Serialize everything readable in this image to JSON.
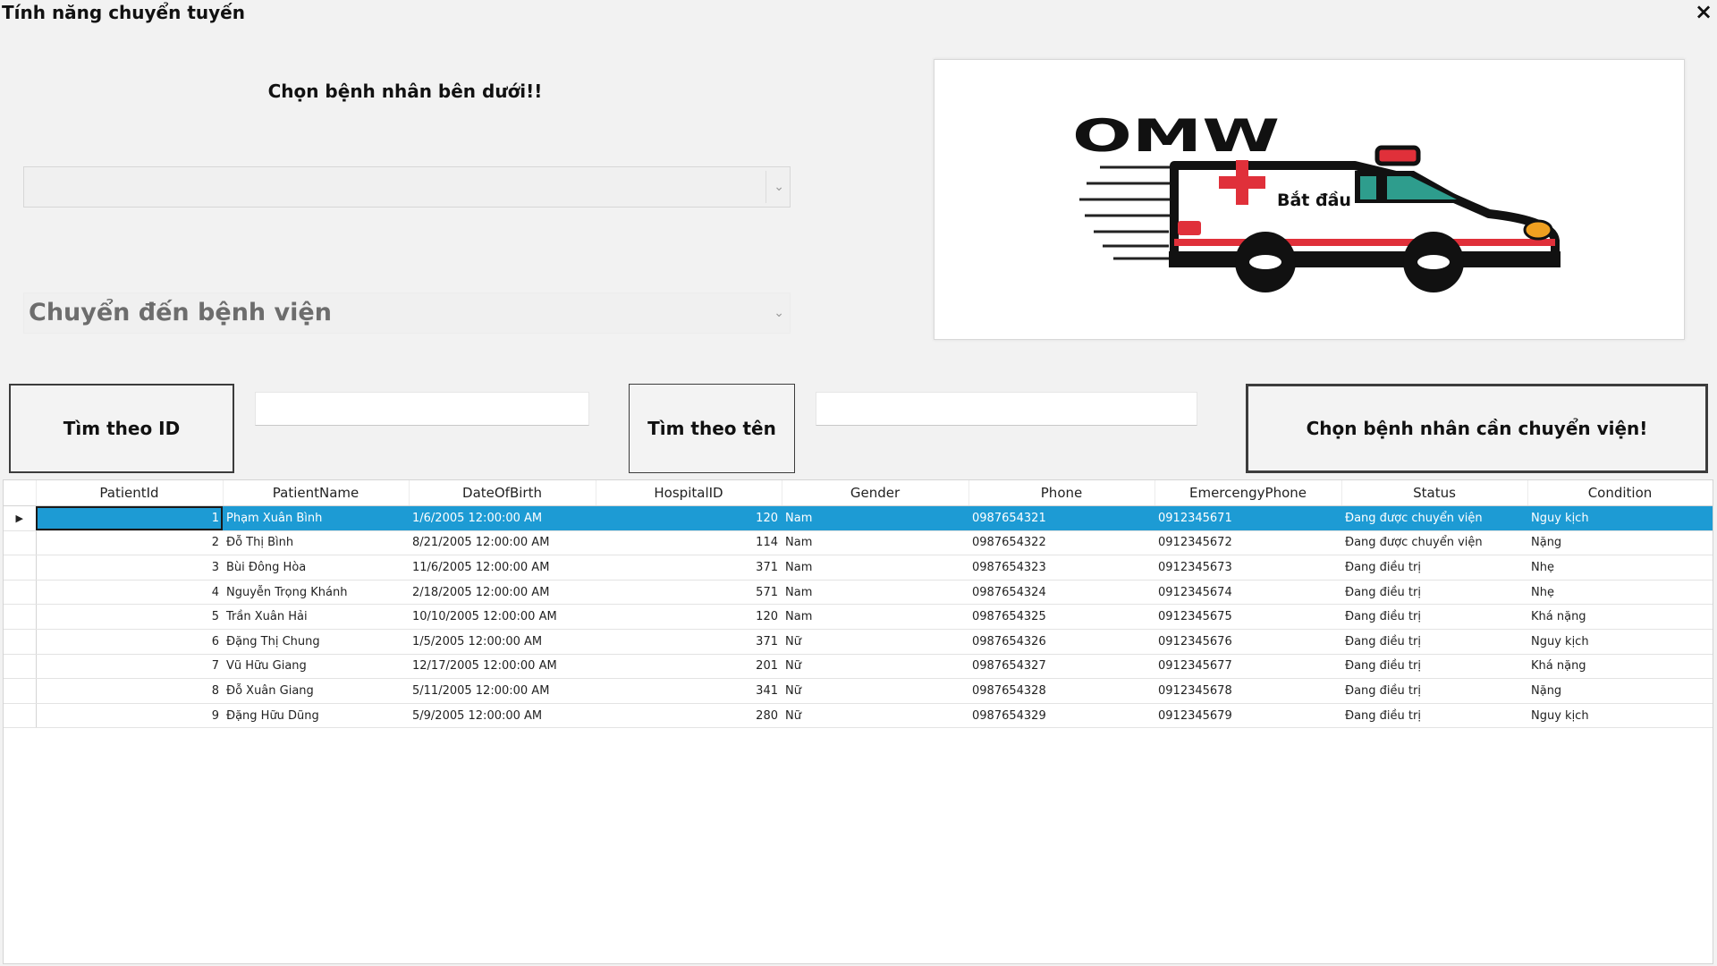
{
  "window": {
    "title": "Tính năng chuyển tuyến",
    "close_icon": "×"
  },
  "form": {
    "prompt_label": "Chọn bệnh nhân bên dưới!!",
    "patient_combo_value": "",
    "hospital_combo_placeholder": "Chuyển đến bệnh viện",
    "combo_arrow": "⌄"
  },
  "logo": {
    "brand_text": "OMW",
    "caption": "Bắt đầu"
  },
  "buttons": {
    "find_by_id": "Tìm theo ID",
    "find_by_name": "Tìm theo tên",
    "transfer": "Chọn bệnh nhân cần chuyển viện!"
  },
  "inputs": {
    "id_value": "",
    "name_value": ""
  },
  "grid": {
    "row_indicator": "▶",
    "columns": [
      "PatientId",
      "PatientName",
      "DateOfBirth",
      "HospitalID",
      "Gender",
      "Phone",
      "EmercengyPhone",
      "Status",
      "Condition"
    ],
    "rows": [
      [
        "1",
        "Phạm Xuân Bình",
        "1/6/2005 12:00:00 AM",
        "120",
        "Nam",
        "0987654321",
        "0912345671",
        "Đang được chuyển viện",
        "Nguy kịch"
      ],
      [
        "2",
        "Đỗ Thị Bình",
        "8/21/2005 12:00:00 AM",
        "114",
        "Nam",
        "0987654322",
        "0912345672",
        "Đang được chuyển viện",
        "Nặng"
      ],
      [
        "3",
        "Bùi Đông Hòa",
        "11/6/2005 12:00:00 AM",
        "371",
        "Nam",
        "0987654323",
        "0912345673",
        "Đang điều trị",
        "Nhẹ"
      ],
      [
        "4",
        "Nguyễn Trọng Khánh",
        "2/18/2005 12:00:00 AM",
        "571",
        "Nam",
        "0987654324",
        "0912345674",
        "Đang điều trị",
        "Nhẹ"
      ],
      [
        "5",
        "Trần Xuân Hải",
        "10/10/2005 12:00:00 AM",
        "120",
        "Nam",
        "0987654325",
        "0912345675",
        "Đang điều trị",
        "Khá nặng"
      ],
      [
        "6",
        "Đặng Thị Chung",
        "1/5/2005 12:00:00 AM",
        "371",
        "Nữ",
        "0987654326",
        "0912345676",
        "Đang điều trị",
        "Nguy kịch"
      ],
      [
        "7",
        "Vũ Hữu Giang",
        "12/17/2005 12:00:00 AM",
        "201",
        "Nữ",
        "0987654327",
        "0912345677",
        "Đang điều trị",
        "Khá nặng"
      ],
      [
        "8",
        "Đỗ Xuân Giang",
        "5/11/2005 12:00:00 AM",
        "341",
        "Nữ",
        "0987654328",
        "0912345678",
        "Đang điều trị",
        "Nặng"
      ],
      [
        "9",
        "Đặng Hữu Dũng",
        "5/9/2005 12:00:00 AM",
        "280",
        "Nữ",
        "0987654329",
        "0912345679",
        "Đang điều trị",
        "Nguy kịch"
      ]
    ],
    "selected_row": 0
  },
  "colors": {
    "selection": "#1d9bd4",
    "ambulance_red": "#e0303a",
    "ambulance_teal": "#2e9d8d",
    "ambulance_dark": "#111111"
  }
}
